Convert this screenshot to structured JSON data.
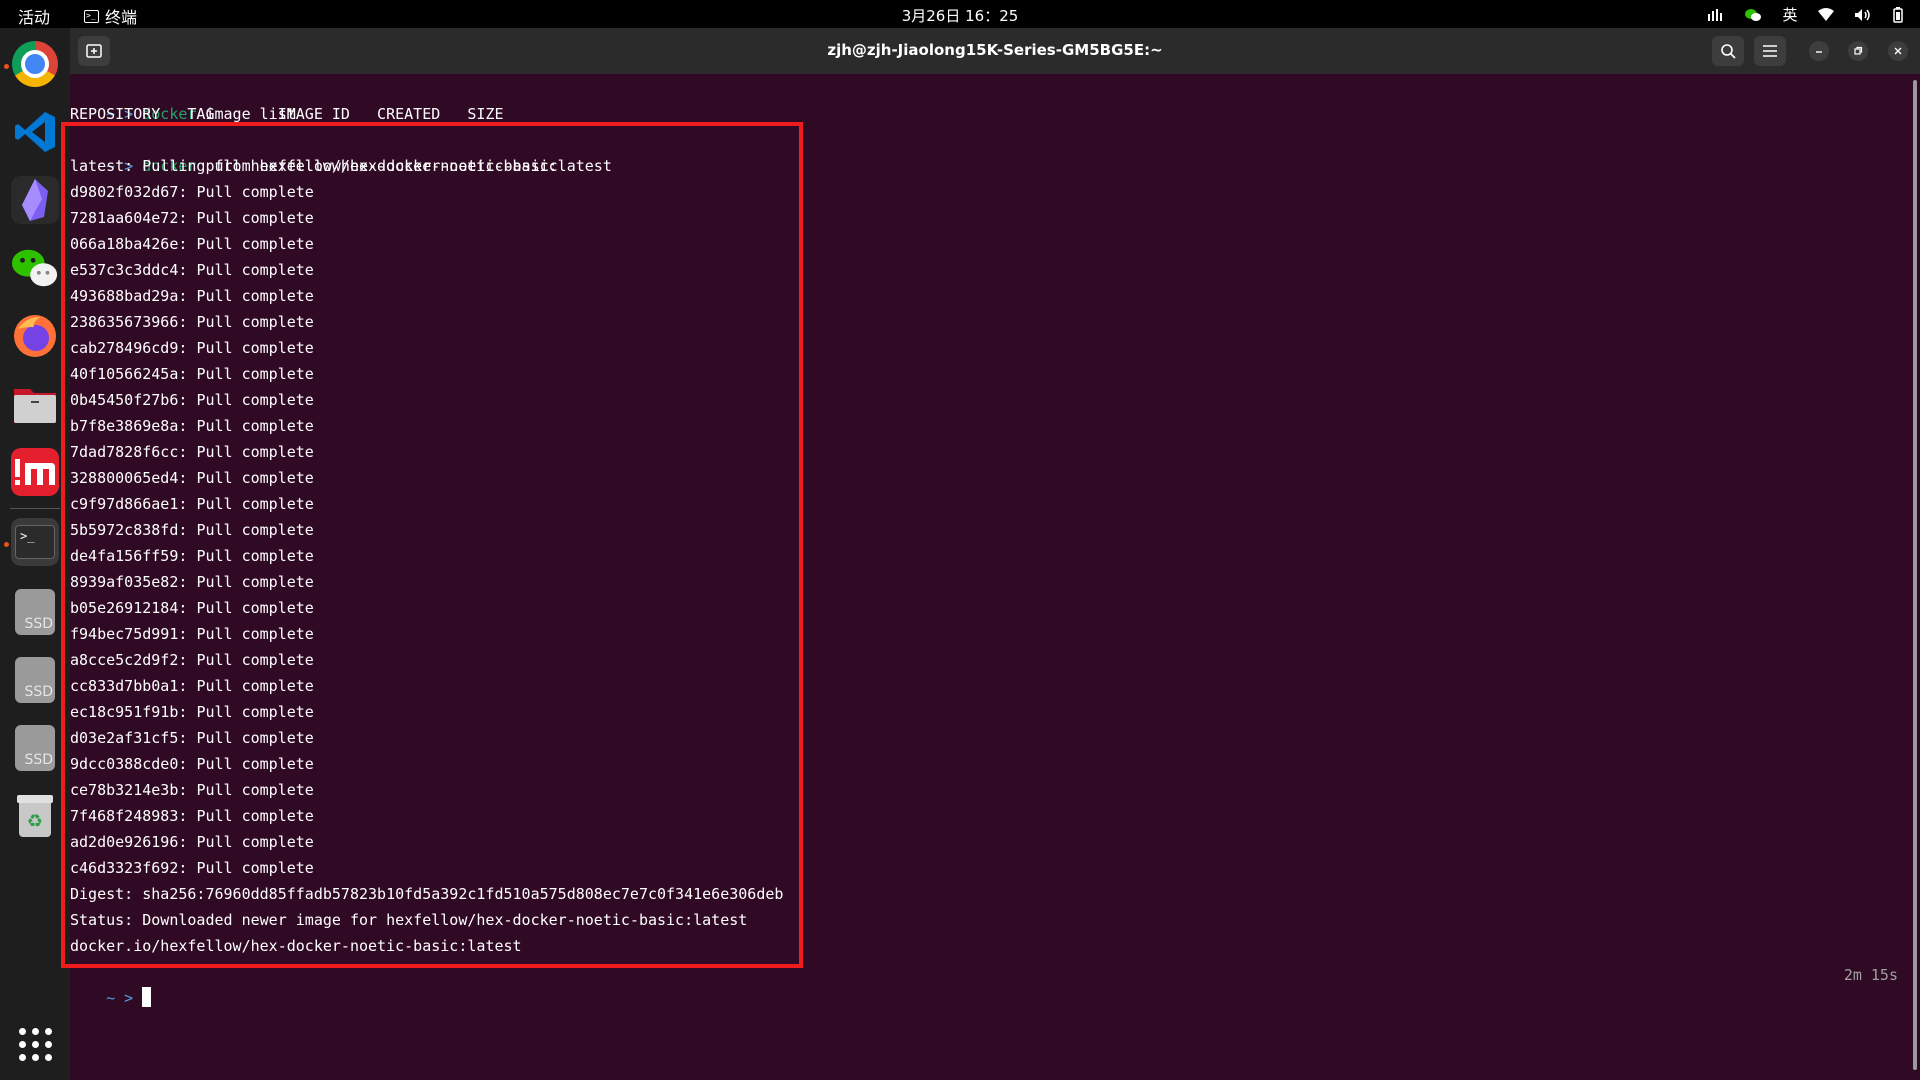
{
  "topbar": {
    "activities": "活动",
    "app_name": "终端",
    "clock": "3月26日 16：25",
    "input_method": "英"
  },
  "dock": {
    "items": [
      "chrome-icon",
      "vscode-icon",
      "obsidian-icon",
      "wechat-icon",
      "firefox-icon",
      "files-icon",
      "notes-icon",
      "terminal-icon",
      "ssd-icon",
      "ssd-icon",
      "ssd-icon",
      "trash-icon",
      "app-grid-icon"
    ],
    "ssd_label": "SSD"
  },
  "terminal": {
    "title": "zjh@zjh-Jiaolong15K-Series-GM5BG5E:~",
    "prompt": "~ >",
    "cmd1": {
      "bin": "docker",
      "args": "image list"
    },
    "image_list_header": "REPOSITORY   TAG       IMAGE ID   CREATED   SIZE",
    "cmd2": {
      "bin": "docker",
      "args": "pull hexfellow/hex-docker-noetic-basic:latest"
    },
    "pulling": "latest: Pulling from hexfellow/hex-docker-noetic-basic",
    "layers": [
      "d9802f032d67",
      "7281aa604e72",
      "066a18ba426e",
      "e537c3c3ddc4",
      "493688bad29a",
      "238635673966",
      "cab278496cd9",
      "40f10566245a",
      "0b45450f27b6",
      "b7f8e3869e8a",
      "7dad7828f6cc",
      "328800065ed4",
      "c9f97d866ae1",
      "5b5972c838fd",
      "de4fa156ff59",
      "8939af035e82",
      "b05e26912184",
      "f94bec75d991",
      "a8cce5c2d9f2",
      "cc833d7bb0a1",
      "ec18c951f91b",
      "d03e2af31cf5",
      "9dcc0388cde0",
      "ce78b3214e3b",
      "7f468f248983",
      "ad2d0e926196",
      "c46d3323f692"
    ],
    "layer_status": "Pull complete",
    "digest": "Digest: sha256:76960dd85ffadb57823b10fd5a392c1fd510a575d808ec7e7c0f341e6e306deb",
    "status": "Status: Downloaded newer image for hexfellow/hex-docker-noetic-basic:latest",
    "image_ref": "docker.io/hexfellow/hex-docker-noetic-basic:latest",
    "elapsed": "2m 15s",
    "highlight_color": "#ee1c1c"
  },
  "colors": {
    "terminal_bg": "#300a24",
    "prompt": "#4e9fe0",
    "command": "#26a269"
  }
}
